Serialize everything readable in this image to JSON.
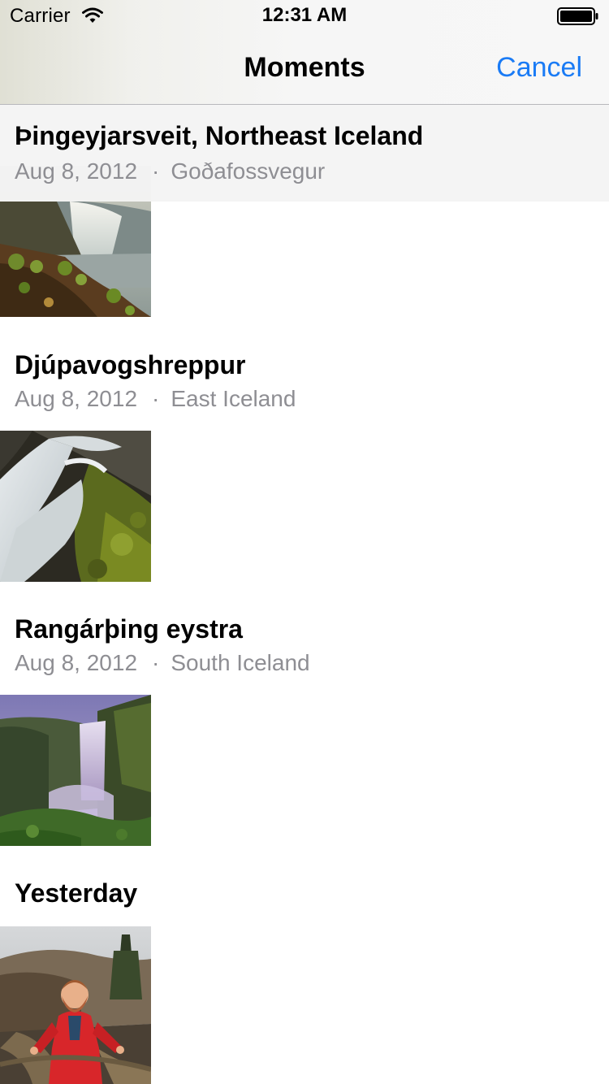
{
  "status_bar": {
    "carrier": "Carrier",
    "time": "12:31 AM",
    "wifi_icon": "wifi-icon",
    "battery_icon": "battery-icon"
  },
  "nav": {
    "title": "Moments",
    "cancel_label": "Cancel",
    "accent_color": "#1a7bf5"
  },
  "moments": [
    {
      "title": "Þingeyjarsveit, Northeast Iceland",
      "date": "Aug 8, 2012",
      "separator": "·",
      "location": "Goðafossvegur",
      "photo": "waterfall-godafoss-thumbnail"
    },
    {
      "title": "Djúpavogshreppur",
      "date": "Aug 8, 2012",
      "separator": "·",
      "location": "East Iceland",
      "photo": "mossy-waterfall-thumbnail"
    },
    {
      "title": "Rangárþing eystra",
      "date": "Aug 8, 2012",
      "separator": "·",
      "location": "South Iceland",
      "photo": "skogafoss-waterfall-thumbnail"
    },
    {
      "title": "Yesterday",
      "photo": "person-red-jacket-thumbnail"
    }
  ]
}
